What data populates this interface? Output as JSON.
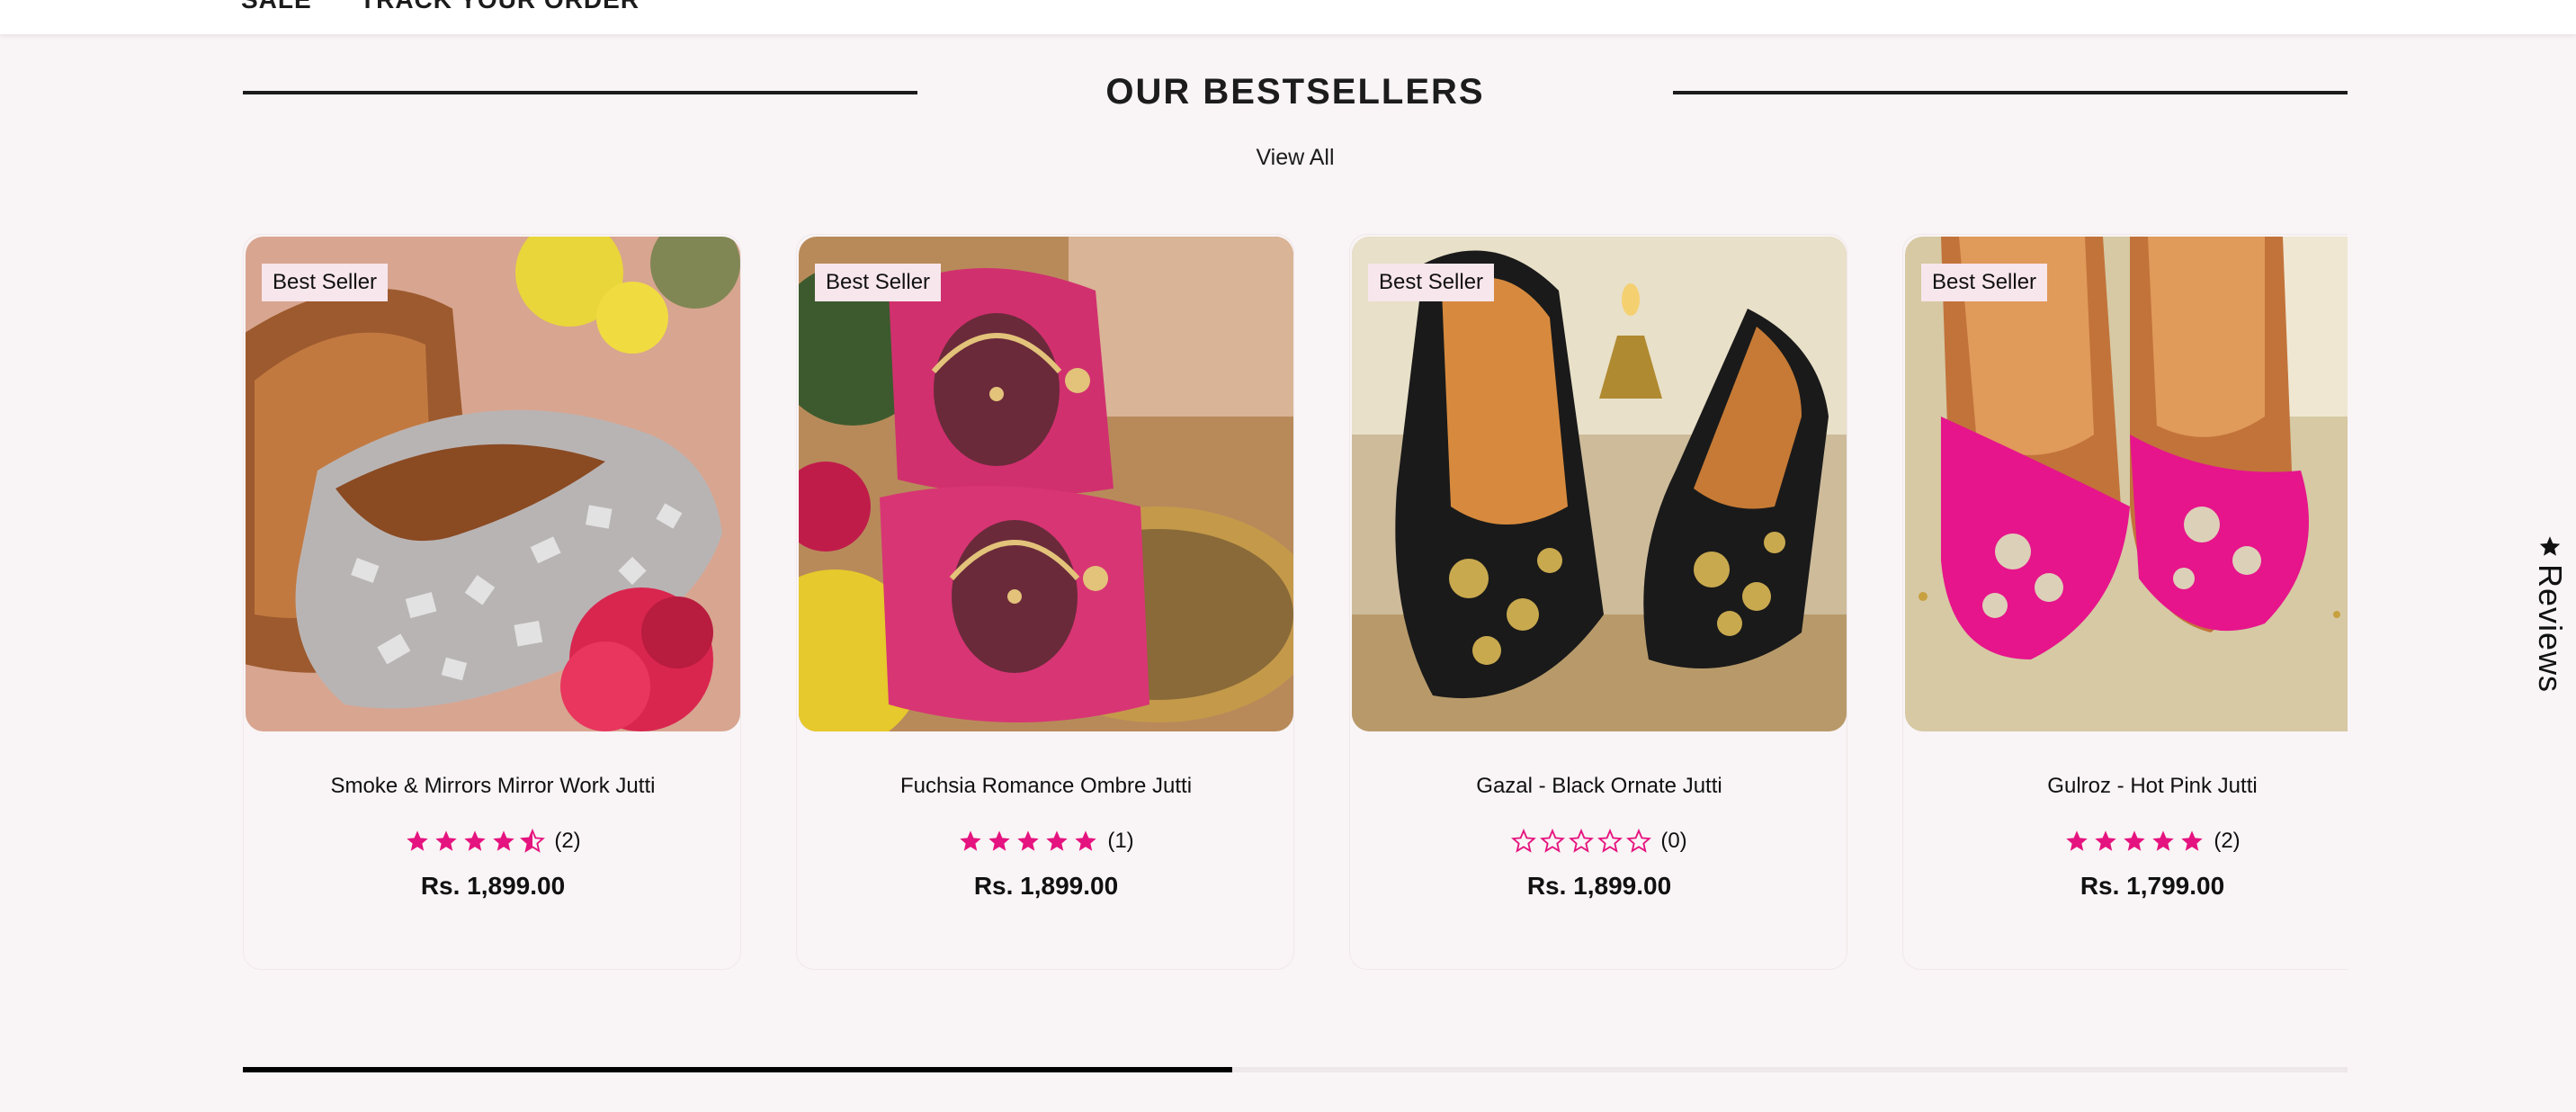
{
  "nav": {
    "items": [
      "SALE",
      "TRACK YOUR ORDER"
    ]
  },
  "section": {
    "title": "OUR BESTSELLERS",
    "view_all": "View All"
  },
  "colors": {
    "star": "#e5137f",
    "background": "#f9f4f5",
    "badge_bg": "#f7e6ec",
    "text": "#1c1c1c"
  },
  "products": [
    {
      "badge": "Best Seller",
      "title": "Smoke & Mirrors Mirror Work Jutti",
      "rating": 4.5,
      "review_count": "(2)",
      "price": "Rs. 1,899.00",
      "image": "silver mirror-work jutti with pink flowers"
    },
    {
      "badge": "Best Seller",
      "title": "Fuchsia Romance Ombre Jutti",
      "rating": 5,
      "review_count": "(1)",
      "price": "Rs. 1,899.00",
      "image": "fuchsia embroidered jutti heels with yellow flowers"
    },
    {
      "badge": "Best Seller",
      "title": "Gazal - Black Ornate Jutti",
      "rating": 0,
      "review_count": "(0)",
      "price": "Rs. 1,899.00",
      "image": "black jutti with gold embroidery"
    },
    {
      "badge": "Best Seller",
      "title": "Gulroz - Hot Pink Jutti",
      "rating": 5,
      "review_count": "(2)",
      "price": "Rs. 1,799.00",
      "image": "hot pink embroidered jutti"
    }
  ],
  "carousel": {
    "progress_fraction": 0.47
  },
  "reviews_tab": {
    "label": "Reviews",
    "icon": "star-icon"
  }
}
